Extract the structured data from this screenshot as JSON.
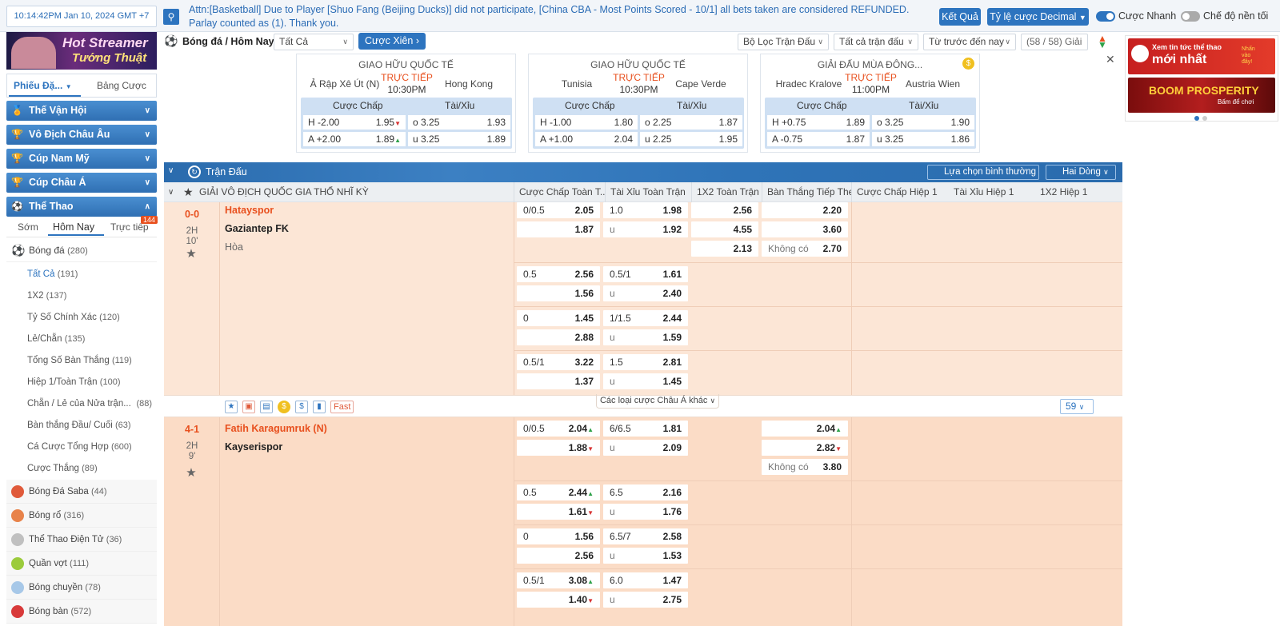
{
  "topbar": {
    "clock": "10:14:42PM Jan 10, 2024 GMT +7",
    "marquee": "Attn:[Basketball] Due to Player [Shuo Fang (Beijing Ducks)] did not participate, [China CBA - Most Points Scored - 10/1] all bets taken are considered REFUNDED. Parlay counted as (1). Thank you.",
    "btn_ketqua": "Kết Quả",
    "btn_tyle": "Tỷ lệ cược Decimal",
    "toggle_fast": "Cược Nhanh",
    "toggle_dark": "Chế độ nền tối"
  },
  "sidebar": {
    "banner_line1": "Hot Streamer",
    "banner_line2": "Tướng Thuật",
    "tab_phieu": "Phiếu Đặ...",
    "tab_bang": "Bảng Cược",
    "heads": [
      "Thế Vận Hội",
      "Vô Địch Châu Âu",
      "Cúp Nam Mỹ",
      "Cúp Châu Á",
      "Thể Thao"
    ],
    "time_tabs": [
      "Sớm",
      "Hôm Nay",
      "Trực tiếp"
    ],
    "live_count": "144",
    "football": "Bóng đá",
    "football_count": "(280)",
    "sub": [
      {
        "label": "Tất Cả",
        "count": "(191)"
      },
      {
        "label": "1X2",
        "count": "(137)"
      },
      {
        "label": "Tỷ Số Chính Xác",
        "count": "(120)"
      },
      {
        "label": "Lẻ/Chẵn",
        "count": "(135)"
      },
      {
        "label": "Tổng Số Bàn Thắng",
        "count": "(119)"
      },
      {
        "label": "Hiệp 1/Toàn Trận",
        "count": "(100)"
      },
      {
        "label": "Chẵn / Lẻ của Nửa trận...",
        "count": "(88)"
      },
      {
        "label": "Bàn thắng Đầu/ Cuối",
        "count": "(63)"
      },
      {
        "label": "Cá Cược Tổng Hợp",
        "count": "(600)"
      },
      {
        "label": "Cược Thắng",
        "count": "(89)"
      }
    ],
    "sports": [
      {
        "label": "Bóng Đá Saba",
        "count": "(44)"
      },
      {
        "label": "Bóng rổ",
        "count": "(316)"
      },
      {
        "label": "Thể Thao Điện Tử",
        "count": "(36)"
      },
      {
        "label": "Quần vợt",
        "count": "(111)"
      },
      {
        "label": "Bóng chuyền",
        "count": "(78)"
      },
      {
        "label": "Bóng bàn",
        "count": "(572)"
      }
    ]
  },
  "mainhead": {
    "title": "Bóng đá / Hôm Nay",
    "filter_all": "Tất Cả",
    "parlay": "Cược Xiên",
    "match_filter": "Bộ Lọc Trận Đấu",
    "all_matches": "Tất cả trận đấu",
    "sort": "Từ trước đến nay",
    "count": "(58 / 58) Giải"
  },
  "cards": [
    {
      "league": "GIAO HỮU QUỐC TẾ",
      "home": "Ả Rập Xê Út (N)",
      "away": "Hong Kong",
      "live": "TRỰC TIẾP",
      "time": "10:30PM",
      "hdp_h": "H -2.00",
      "hdp_h_odd": "1.95",
      "hdp_a": "A +2.00",
      "hdp_a_odd": "1.89",
      "ou_o": "o 3.25",
      "ou_o_odd": "1.93",
      "ou_u": "u 3.25",
      "ou_u_odd": "1.89"
    },
    {
      "league": "GIAO HỮU QUỐC TẾ",
      "home": "Tunisia",
      "away": "Cape Verde",
      "live": "TRỰC TIẾP",
      "time": "10:30PM",
      "hdp_h": "H -1.00",
      "hdp_h_odd": "1.80",
      "hdp_a": "A +1.00",
      "hdp_a_odd": "2.04",
      "ou_o": "o 2.25",
      "ou_o_odd": "1.87",
      "ou_u": "u 2.25",
      "ou_u_odd": "1.95"
    },
    {
      "league": "GIẢI ĐẤU MÙA ĐÔNG...",
      "home": "Hradec Kralove",
      "away": "Austria Wien",
      "live": "TRỰC TIẾP",
      "time": "11:00PM",
      "hdp_h": "H +0.75",
      "hdp_h_odd": "1.89",
      "hdp_a": "A -0.75",
      "hdp_a_odd": "1.87",
      "ou_o": "o 3.25",
      "ou_o_odd": "1.90",
      "ou_u": "u 3.25",
      "ou_u_odd": "1.86"
    }
  ],
  "card_labels": {
    "hdp": "Cược Chấp",
    "ou": "Tài/Xỉu"
  },
  "promo": {
    "p1": "Xem tin tức thể thao",
    "p1b": "mới nhất",
    "p1c": "Nhấn vào đây!",
    "p2": "BOOM PROSPERITY",
    "p2b": "Bấm để chơi"
  },
  "section": {
    "title": "Trận Đấu",
    "select": "Lựa chọn bình thường",
    "lines": "Hai Dòng"
  },
  "columns": {
    "league": "GIẢI VÔ ĐỊCH QUỐC GIA THỔ NHĨ KỲ",
    "c1": "Cược Chấp Toàn T...",
    "c2": "Tài Xỉu Toàn Trận",
    "c3": "1X2 Toàn Trận",
    "c4": "Bàn Thắng Tiếp Theo",
    "c5": "Cược Chấp Hiệp 1",
    "c6": "Tài Xỉu Hiệp 1",
    "c7": "1X2 Hiệp 1"
  },
  "match1": {
    "score": "0-0",
    "half": "2H",
    "minute": "10'",
    "home": "Hatayspor",
    "away": "Gaziantep FK",
    "draw": "Hòa",
    "rows": [
      {
        "hdp": "0/0.5",
        "h1": "2.05",
        "h2": "1.87",
        "ou": "1.0",
        "o1": "1.98",
        "o2": "1.92"
      },
      {
        "hdp": "0.5",
        "h1": "2.56",
        "h2": "1.56",
        "ou": "0.5/1",
        "o1": "1.61",
        "o2": "2.40"
      },
      {
        "hdp": "0",
        "h1": "1.45",
        "h2": "2.88",
        "ou": "1/1.5",
        "o1": "2.44",
        "o2": "1.59"
      },
      {
        "hdp": "0.5/1",
        "h1": "3.22",
        "h2": "1.37",
        "ou": "1.5",
        "o1": "2.81",
        "o2": "1.45"
      }
    ],
    "x12": [
      "2.56",
      "4.55",
      "2.13"
    ],
    "next": [
      "2.20",
      "3.60",
      "2.70"
    ],
    "no_goal": "Không có",
    "u": "u"
  },
  "toolbar": {
    "fast": "Fast",
    "more": "Các loại cược Châu Á khác",
    "count": "59"
  },
  "match2": {
    "score": "4-1",
    "half": "2H",
    "minute": "9'",
    "home": "Fatih Karagumruk (N)",
    "away": "Kayserispor",
    "rows": [
      {
        "hdp": "0/0.5",
        "h1": "2.04",
        "h2": "1.88",
        "ou": "6/6.5",
        "o1": "1.81",
        "o2": "2.09"
      },
      {
        "hdp": "0.5",
        "h1": "2.44",
        "h2": "1.61",
        "ou": "6.5",
        "o1": "2.16",
        "o2": "1.76"
      },
      {
        "hdp": "0",
        "h1": "1.56",
        "h2": "2.56",
        "ou": "6.5/7",
        "o1": "2.58",
        "o2": "1.53"
      },
      {
        "hdp": "0.5/1",
        "h1": "3.08",
        "h2": "1.40",
        "ou": "6.0",
        "o1": "1.47",
        "o2": "2.75"
      }
    ],
    "next": [
      "2.04",
      "2.82",
      "3.80"
    ],
    "no_goal": "Không có"
  }
}
